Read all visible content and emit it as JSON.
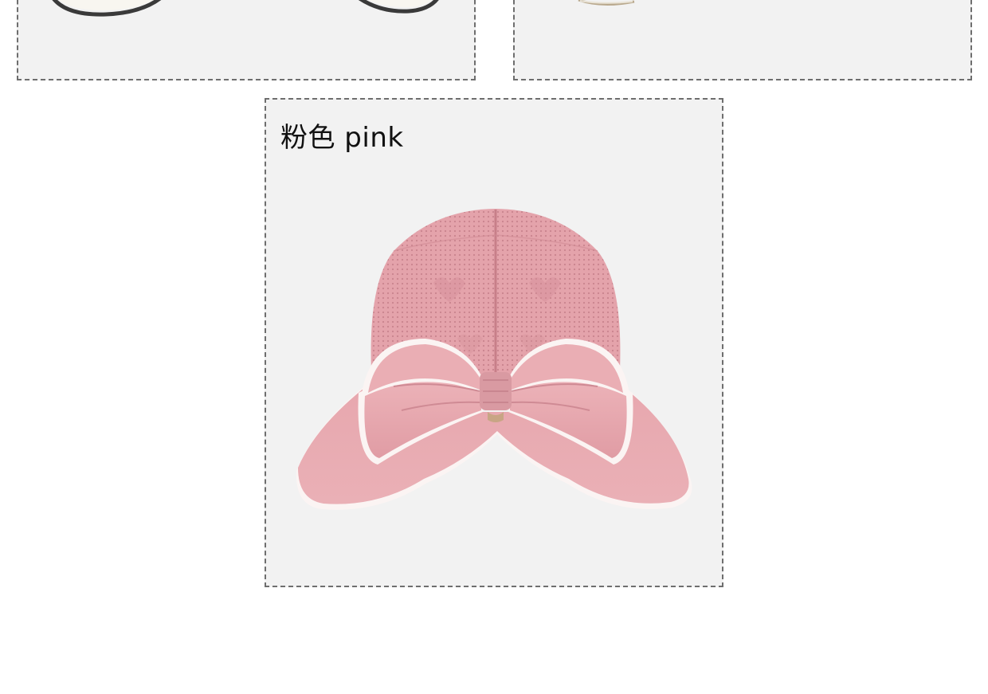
{
  "cards": [
    {
      "id": "top-left",
      "image": {
        "subject": "white-hat-with-dark-brim",
        "partially_visible": true
      }
    },
    {
      "id": "top-right",
      "image": {
        "subject": "hat-partially-visible",
        "partially_visible": true
      }
    },
    {
      "id": "pink",
      "label": "粉色  pink",
      "image": {
        "subject": "pink-knit-sun-visor-hat-with-bow"
      }
    }
  ],
  "colors": {
    "card_bg": "#f2f2f2",
    "border": "#6e6e6e",
    "hat_pink": "#e7a9b0",
    "hat_pink_dark": "#d58b95",
    "trim": "#fbf4f3"
  }
}
